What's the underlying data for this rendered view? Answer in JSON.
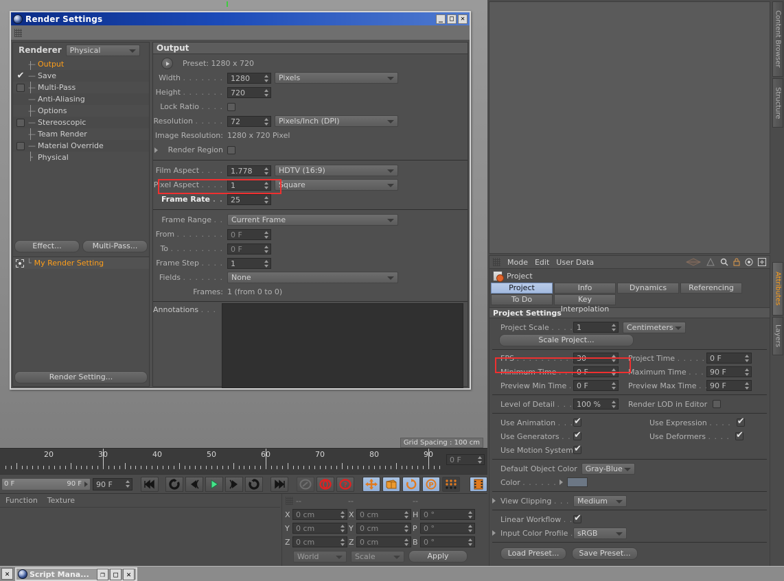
{
  "render_settings_window": {
    "title": "Render Settings",
    "window_buttons": [
      "_",
      "□",
      "✕"
    ],
    "renderer_label": "Renderer",
    "renderer_value": "Physical",
    "tree": [
      {
        "label": "Output",
        "checkbox": "none",
        "selected": true
      },
      {
        "label": "Save",
        "checkbox": "checked",
        "selected": false
      },
      {
        "label": "Multi-Pass",
        "checkbox": "empty",
        "selected": false
      },
      {
        "label": "Anti-Aliasing",
        "checkbox": "none",
        "selected": false
      },
      {
        "label": "Options",
        "checkbox": "none",
        "selected": false
      },
      {
        "label": "Stereoscopic",
        "checkbox": "empty",
        "selected": false
      },
      {
        "label": "Team Render",
        "checkbox": "none",
        "selected": false
      },
      {
        "label": "Material Override",
        "checkbox": "empty",
        "selected": false
      },
      {
        "label": "Physical",
        "checkbox": "none",
        "selected": false
      }
    ],
    "effect_button": "Effect...",
    "multipass_button": "Multi-Pass...",
    "preset_name": "My Render Setting",
    "render_setting_button": "Render Setting...",
    "output": {
      "header": "Output",
      "preset_text": "Preset: 1280 x 720",
      "width_label": "Width",
      "width_value": "1280",
      "width_unit": "Pixels",
      "height_label": "Height",
      "height_value": "720",
      "lock_ratio_label": "Lock Ratio",
      "lock_ratio_checked": false,
      "resolution_label": "Resolution",
      "resolution_value": "72",
      "resolution_unit": "Pixels/Inch (DPI)",
      "image_resolution_label": "Image Resolution:",
      "image_resolution_value": "1280 x 720 Pixel",
      "render_region_label": "Render Region",
      "render_region_checked": false,
      "film_aspect_label": "Film Aspect",
      "film_aspect_value": "1.778",
      "film_aspect_preset": "HDTV (16:9)",
      "pixel_aspect_label": "Pixel Aspect",
      "pixel_aspect_value": "1",
      "pixel_aspect_preset": "Square",
      "frame_rate_label": "Frame Rate",
      "frame_rate_value": "25",
      "frame_rate_highlighted": true,
      "frame_range_label": "Frame Range",
      "frame_range_value": "Current Frame",
      "from_label": "From",
      "from_value": "0 F",
      "to_label": "To",
      "to_value": "0 F",
      "frame_step_label": "Frame Step",
      "frame_step_value": "1",
      "fields_label": "Fields",
      "fields_value": "None",
      "frames_label": "Frames:",
      "frames_value": "1 (from 0 to 0)",
      "annotations_label": "Annotations",
      "annotations_value": ""
    }
  },
  "viewport": {
    "grid_spacing": "Grid Spacing : 100 cm"
  },
  "attribute_manager": {
    "menu": [
      "Mode",
      "Edit",
      "User Data"
    ],
    "icons": [
      "layers-icon",
      "axis-icon",
      "search-icon",
      "lock-icon",
      "target-icon",
      "plus-icon"
    ],
    "object_name": "Project",
    "tabs_row1": [
      "Project Settings",
      "Info",
      "Dynamics",
      "Referencing"
    ],
    "tabs_row2": [
      "To Do",
      "Key Interpolation"
    ],
    "active_tab": "Project Settings",
    "section_header": "Project Settings",
    "fields": {
      "project_scale_label": "Project Scale",
      "project_scale_value": "1",
      "project_scale_unit": "Centimeters",
      "scale_project_button": "Scale Project...",
      "fps_label": "FPS",
      "fps_value": "30",
      "fps_highlighted": true,
      "project_time_label": "Project Time",
      "project_time_value": "0 F",
      "minimum_time_label": "Minimum Time",
      "minimum_time_value": "0 F",
      "maximum_time_label": "Maximum Time",
      "maximum_time_value": "90 F",
      "preview_min_time_label": "Preview Min Time",
      "preview_min_time_value": "0 F",
      "preview_max_time_label": "Preview Max Time",
      "preview_max_time_value": "90 F",
      "level_of_detail_label": "Level of Detail",
      "level_of_detail_value": "100 %",
      "render_lod_label": "Render LOD in Editor",
      "render_lod_checked": false,
      "use_animation_label": "Use Animation",
      "use_animation_checked": true,
      "use_expression_label": "Use Expression",
      "use_expression_checked": true,
      "use_generators_label": "Use Generators",
      "use_generators_checked": true,
      "use_deformers_label": "Use Deformers",
      "use_deformers_checked": true,
      "use_motion_system_label": "Use Motion System",
      "use_motion_system_checked": true,
      "default_object_color_label": "Default Object Color",
      "default_object_color_value": "Gray-Blue",
      "color_label": "Color",
      "color_swatch": "#6c7785",
      "view_clipping_label": "View Clipping",
      "view_clipping_value": "Medium",
      "linear_workflow_label": "Linear Workflow",
      "linear_workflow_checked": true,
      "input_color_profile_label": "Input Color Profile",
      "input_color_profile_value": "sRGB",
      "load_preset_button": "Load Preset...",
      "save_preset_button": "Save Preset..."
    }
  },
  "side_tabs": [
    {
      "label": "Content Browser",
      "active": false
    },
    {
      "label": "Structure",
      "active": false
    },
    {
      "label": "Attributes",
      "active": true
    },
    {
      "label": "Layers",
      "active": false
    }
  ],
  "timeline": {
    "tick_labels": [
      "20",
      "30",
      "40",
      "50",
      "60",
      "70",
      "80",
      "90"
    ],
    "current_frame": "0 F",
    "range_start": "0 F",
    "range_end": "90 F",
    "end_frame_field": "90 F",
    "transport_icons": [
      "go-to-start-icon",
      "rewind-loop-icon",
      "previous-key-icon",
      "play-icon",
      "next-key-icon",
      "loop-icon",
      "go-to-end-icon"
    ],
    "mode_icons": [
      "record-autokey-icon",
      "record-icon",
      "record-help-icon"
    ],
    "key_icons": [
      "move-key-icon",
      "scale-key-icon",
      "rotate-key-icon",
      "parameter-key-icon",
      "point-level-icon"
    ],
    "timeline_icon": "timeline-icon"
  },
  "lower_panels": {
    "menu": [
      "Function",
      "Texture"
    ],
    "coord_header": [
      "--",
      "--",
      "--"
    ],
    "rows": [
      {
        "a_label": "X",
        "a_value": "0 cm",
        "b_label": "X",
        "b_value": "0 cm",
        "c_label": "H",
        "c_value": "0 °"
      },
      {
        "a_label": "Y",
        "a_value": "0 cm",
        "b_label": "Y",
        "b_value": "0 cm",
        "c_label": "P",
        "c_value": "0 °"
      },
      {
        "a_label": "Z",
        "a_value": "0 cm",
        "b_label": "Z",
        "b_value": "0 cm",
        "c_label": "B",
        "c_value": "0 °"
      }
    ],
    "world_select": "World",
    "scale_select": "Scale",
    "apply_button": "Apply"
  },
  "taskbar": {
    "close_icon": "✕",
    "app_title": "Script Mana...",
    "app_buttons": [
      "❐",
      "□",
      "✕"
    ]
  },
  "colors": {
    "accent_orange": "#ff9f1a",
    "highlight_red": "#f03030",
    "titlebar_blue": "#1b4ab8",
    "tab_active_blue": "#a4bbe0"
  }
}
